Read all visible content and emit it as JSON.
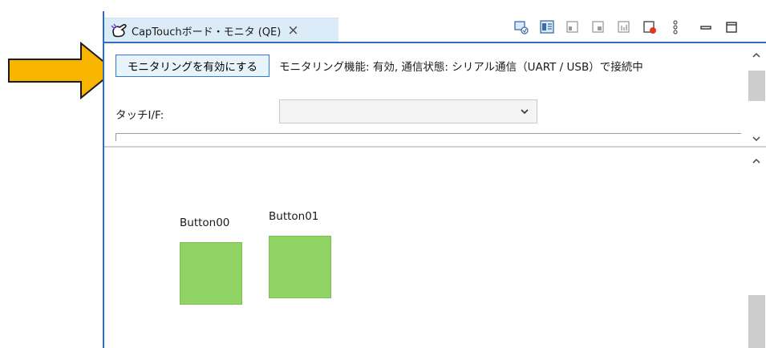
{
  "tab": {
    "title": "CapTouchボード・モニタ (QE)",
    "close_glyph": "×",
    "icon": "captouch-hand-icon"
  },
  "toolbar_icons": [
    "view-toggle-icon",
    "panel-view-icon",
    "layout-a-icon",
    "layout-b-icon",
    "layout-c-icon",
    "record-icon",
    "more-vertical-icon",
    "minimize-icon",
    "maximize-icon"
  ],
  "monitor": {
    "enable_button": "モニタリングを有効にする",
    "status": "モニタリング機能: 有効, 通信状態: シリアル通信（UART / USB）で接続中"
  },
  "touch_interface": {
    "label": "タッチI/F:",
    "value": ""
  },
  "canvas": {
    "buttons": [
      {
        "label": "Button00"
      },
      {
        "label": "Button01"
      }
    ]
  },
  "colors": {
    "accent": "#2e6fb7",
    "button_fill": "#8fd465",
    "arrow_fill": "#f7b500"
  }
}
